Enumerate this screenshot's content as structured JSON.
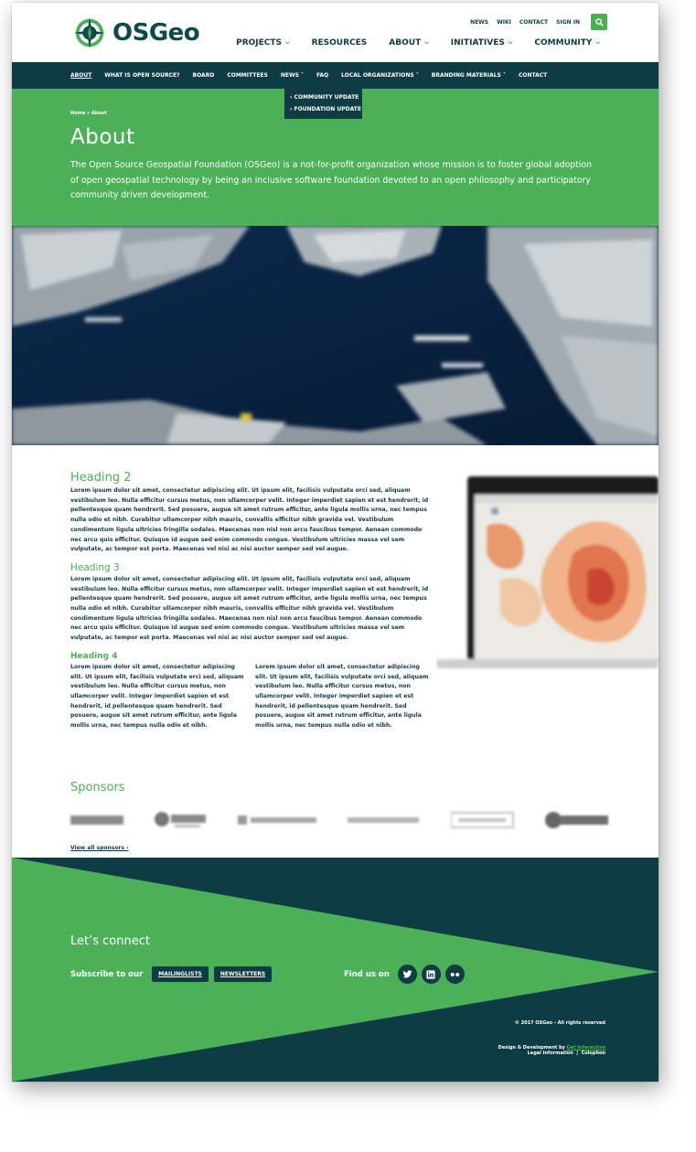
{
  "header": {
    "logo_text": "OSGeo",
    "utility_links": [
      "NEWS",
      "WIKI",
      "CONTACT",
      "SIGN IN"
    ],
    "search_icon": "search-icon",
    "main_nav": [
      {
        "label": "PROJECTS",
        "has_caret": true
      },
      {
        "label": "RESOURCES",
        "has_caret": false
      },
      {
        "label": "ABOUT",
        "has_caret": true
      },
      {
        "label": "INITIATIVES",
        "has_caret": true
      },
      {
        "label": "COMMUNITY",
        "has_caret": true
      }
    ]
  },
  "subnav": {
    "items": [
      {
        "label": "ABOUT",
        "active": true
      },
      {
        "label": "WHAT IS OPEN SOURCE?",
        "active": false
      },
      {
        "label": "BOARD",
        "active": false
      },
      {
        "label": "COMMITTEES",
        "active": false
      },
      {
        "label": "NEWS ˅",
        "active": false
      },
      {
        "label": "FAQ",
        "active": false
      },
      {
        "label": "LOCAL ORGANIZATIONS ˅",
        "active": false
      },
      {
        "label": "BRANDING MATERIALS ˅",
        "active": false
      },
      {
        "label": "CONTACT",
        "active": false
      }
    ],
    "dropdown": [
      "› COMMUNITY UPDATE",
      "› FOUNDATION UPDATE"
    ]
  },
  "hero": {
    "breadcrumb": "Home » About",
    "title": "About",
    "intro": "The Open Source Geospatial Foundation (OSGeo) is a not-for-profit organization whose mission is to foster global adoption of open geospatial technology by being an inclusive software foundation devoted to an open philosophy and participatory community driven development."
  },
  "content": {
    "heading2": "Heading 2",
    "para2": "Lorem ipsum dolor sit amet, consectetur adipiscing elit. Ut ipsum elit, facilisis vulputate orci sed, aliquam vestibulum leo. Nulla efficitur cursus metus, non ullamcorper velit. Integer imperdiet sapien et est hendrerit, id pellentesque quam hendrerit. Sed posuere, augue sit amet rutrum efficitur, ante ligula mollis urna, nec tempus nulla odio et nibh. Curabitur ullamcorper nibh mauris, convallis efficitur nibh gravida vel. Vestibulum condimentum ligula ultricies fringilla sodales. Maecenas non nisl non arcu faucibus tempor. Aenean commodo nec arcu quis efficitur. Quisque id augue sed enim commodo congue. Vestibulum ultricies massa vel sem vulputate, ac tempor est porta. Maecenas vel nisi ac nisi auctor semper sed vel augue.",
    "heading3": "Heading 3",
    "para3": "Lorem ipsum dolor sit amet, consectetur adipiscing elit. Ut ipsum elit, facilisis vulputate orci sed, aliquam vestibulum leo. Nulla efficitur cursus metus, non ullamcorper velit. Integer imperdiet sapien et est hendrerit, id pellentesque quam hendrerit. Sed posuere, augue sit amet rutrum efficitur, ante ligula mollis urna, nec tempus nulla odio et nibh. Curabitur ullamcorper nibh mauris, convallis efficitur nibh gravida vel. Vestibulum condimentum ligula ultricies fringilla sodales. Maecenas non nisl non arcu faucibus tempor. Aenean commodo nec arcu quis efficitur. Quisque id augue sed enim commodo congue. Vestibulum ultricies massa vel sem vulputate, ac tempor est porta. Maecenas vel nisi ac nisi auctor semper sed vel augue.",
    "heading4": "Heading 4",
    "col1": "Lorem ipsum dolor sit amet, consectetur adipiscing elit. Ut ipsum elit, facilisis vulputate orci sed, aliquam vestibulum leo. Nulla efficitur cursus metus, non ullamcorper velit. Integer imperdiet sapien et est hendrerit, id pellentesque quam hendrerit. Sed posuere, augue sit amet rutrum efficitur, ante ligula mollis urna, nec tempus nulla odio et nibh.",
    "col2": "Lorem ipsum dolor sit amet, consectetur adipiscing elit. Ut ipsum elit, facilisis vulputate orci sed, aliquam vestibulum leo. Nulla efficitur cursus metus, non ullamcorper velit. Integer imperdiet sapien et est hendrerit, id pellentesque quam hendrerit. Sed posuere, augue sit amet rutrum efficitur, ante ligula mollis urna, nec tempus nulla odio et nibh."
  },
  "sponsors": {
    "title": "Sponsors",
    "view_all": "View all sponsors  ›"
  },
  "footer": {
    "connect": "Let’s connect",
    "subscribe_label": "Subscribe to our",
    "mailinglists": "MAILINGLISTS",
    "newsletters": "NEWSLETTERS",
    "find_us": "Find us on",
    "social_icons": [
      "twitter-icon",
      "linkedin-icon",
      "flickr-icon"
    ],
    "copyright": "© 2017 OSGeo - All rights reserved",
    "credits_prefix": "Design & Development by",
    "credits_brand": "Get Interactive",
    "legal": "Legal Information",
    "colophon": "Colophon"
  },
  "colors": {
    "green": "#4cb058",
    "dark_teal": "#0e3c44",
    "text_dark": "#0f3b45"
  }
}
